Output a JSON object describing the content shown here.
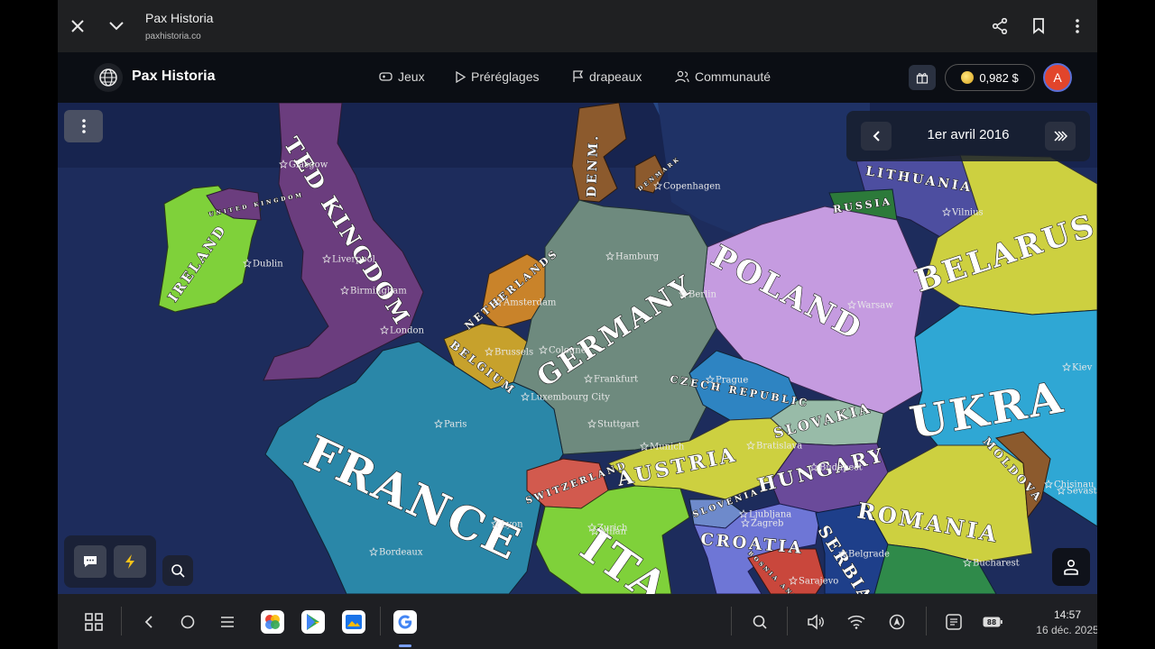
{
  "browser": {
    "title": "Pax Historia",
    "url": "paxhistoria.co"
  },
  "site": {
    "name": "Pax Historia",
    "nav": [
      {
        "label": "Jeux",
        "icon": "gamepad-icon"
      },
      {
        "label": "Préréglages",
        "icon": "play-icon"
      },
      {
        "label": "drapeaux",
        "icon": "flag-icon"
      },
      {
        "label": "Communauté",
        "icon": "users-icon"
      }
    ],
    "balance": "0,982 $",
    "avatar_letter": "A"
  },
  "map": {
    "date": "1er avril 2016",
    "countries": [
      "TED KINGDOM",
      "IRELAND",
      "UNITED KINGDOM",
      "DENM.",
      "DENMARK",
      "LITHUANIA",
      "RUSSIA",
      "BELARUS",
      "POLAND",
      "NETHERLANDS",
      "BELGIUM",
      "GERMANY",
      "CZECH REPUBLIC",
      "SLOVAKIA",
      "UKRA",
      "MOLDOVA",
      "AUSTRIA",
      "HUNGARY",
      "ROMANIA",
      "SWITZERLAND",
      "FRANCE",
      "SLOVENIA",
      "CROATIA",
      "SERBIA",
      "BOSNIA AND HERZEGOVINA",
      "ITA"
    ],
    "cities": [
      "Glasgow",
      "Dublin",
      "Liverpool",
      "Birmingham",
      "London",
      "Copenhagen",
      "Vilnius",
      "Hamburg",
      "Berlin",
      "Warsaw",
      "Amsterdam",
      "Brussels",
      "Cologne",
      "Frankfurt",
      "Prague",
      "Kiev",
      "Luxembourg City",
      "Paris",
      "Stuttgart",
      "Munich",
      "Bratislava",
      "Budapest",
      "Chisinau",
      "Sevastopol",
      "Zurich",
      "Milan",
      "Lyon",
      "Bordeaux",
      "Ljubljana",
      "Zagreb",
      "Belgrade",
      "Sarajevo",
      "Bucharest"
    ]
  },
  "taskbar": {
    "time": "14:57",
    "date": "16 déc. 2025",
    "battery": "88"
  }
}
